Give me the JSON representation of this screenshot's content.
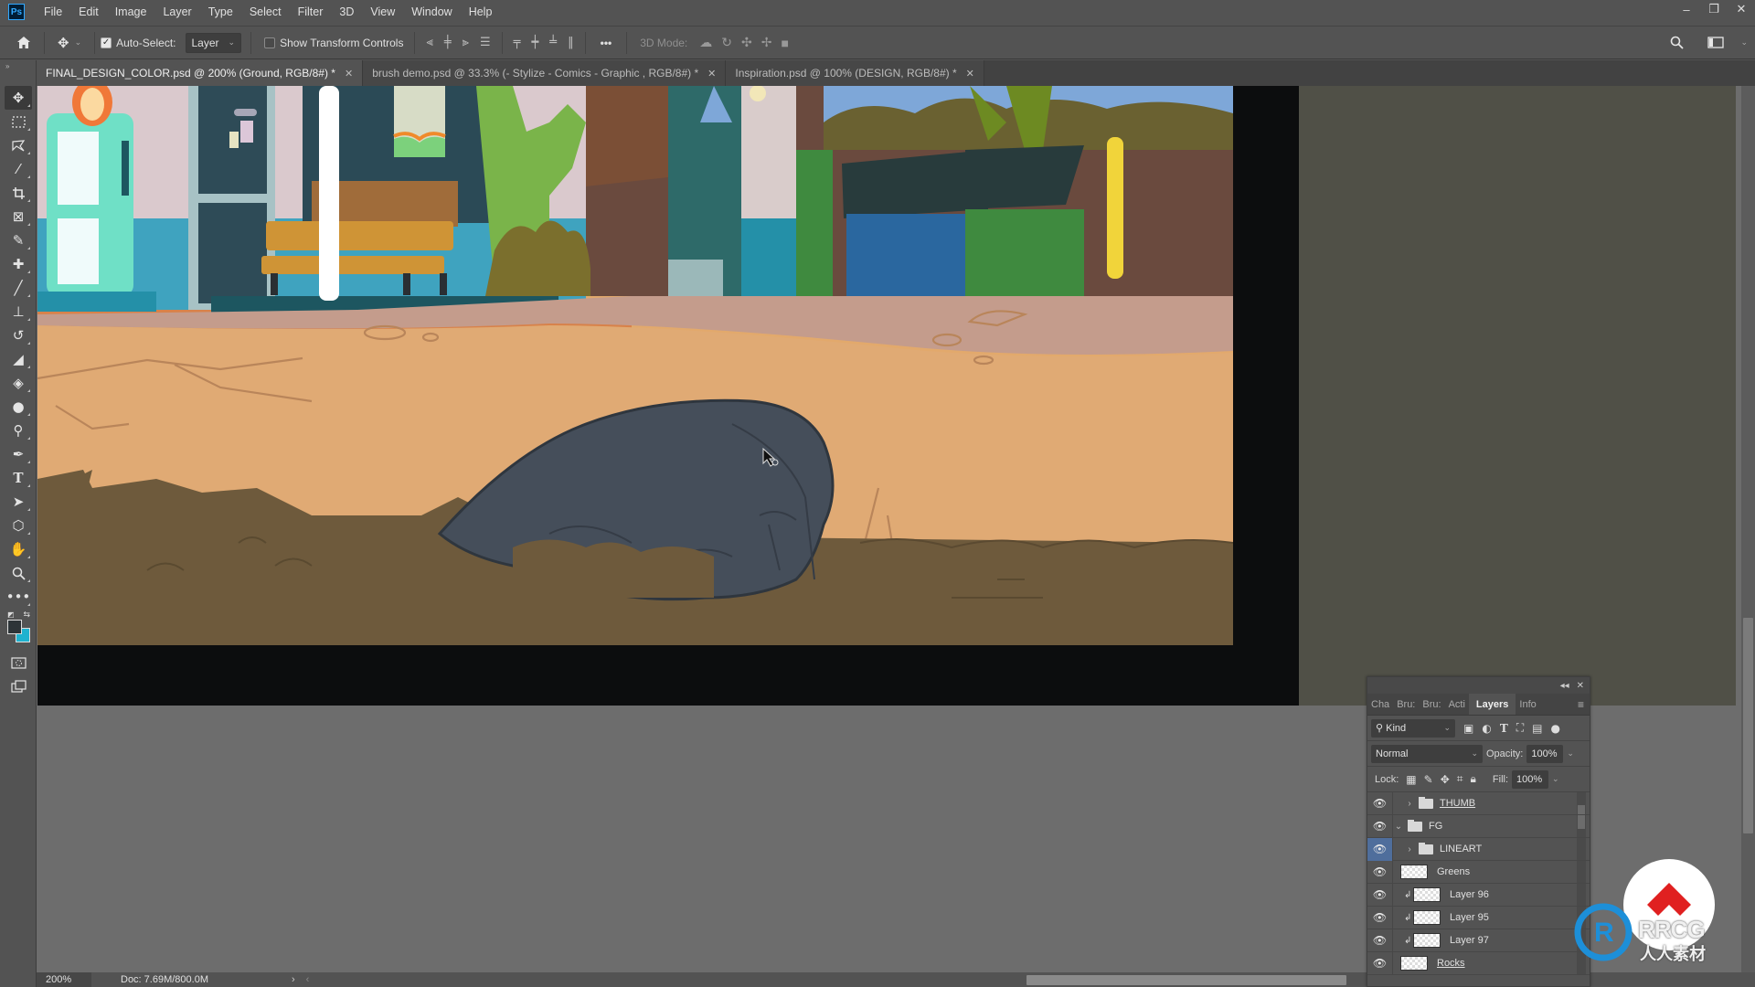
{
  "app": {
    "logo": "Ps",
    "name": "Adobe Photoshop"
  },
  "menu": [
    "File",
    "Edit",
    "Image",
    "Layer",
    "Type",
    "Select",
    "Filter",
    "3D",
    "View",
    "Window",
    "Help"
  ],
  "window_controls": {
    "minimize": "–",
    "restore": "❐",
    "close": "✕"
  },
  "options_bar": {
    "auto_select_label": "Auto-Select:",
    "auto_select_checked": true,
    "auto_select_target": "Layer",
    "show_transform_label": "Show Transform Controls",
    "show_transform_checked": false,
    "more_label": "•••",
    "mode_3d_label": "3D Mode:"
  },
  "tabs": [
    {
      "label": "FINAL_DESIGN_COLOR.psd @ 200% (Ground, RGB/8#) *",
      "active": true
    },
    {
      "label": "brush demo.psd @ 33.3% (- Stylize - Comics - Graphic  , RGB/8#) *",
      "active": false
    },
    {
      "label": "Inspiration.psd @ 100% (DESIGN, RGB/8#) *",
      "active": false
    }
  ],
  "tools": [
    "move",
    "rectangular-marquee",
    "lasso",
    "magic-wand",
    "crop",
    "frame",
    "eyedropper",
    "healing-brush",
    "brush",
    "clone-stamp",
    "history-brush",
    "eraser",
    "paint-bucket",
    "blur",
    "dodge",
    "pen",
    "type",
    "path-selection",
    "shape",
    "hand",
    "zoom",
    "edit-toolbar",
    "quick-mask",
    "screen-mode"
  ],
  "colors": {
    "foreground": "#2d3438",
    "background": "#1fb2cf",
    "selection_accent": "#4f6e9c"
  },
  "status": {
    "zoom": "200%",
    "doc": "Doc: 7.69M/800.0M",
    "arrow": "›",
    "back": "‹"
  },
  "layers_panel": {
    "tabs": [
      "Cha",
      "Bru:",
      "Bru:",
      "Acti",
      "Layers",
      "Info"
    ],
    "active_tab": "Layers",
    "filter_kind": "Kind",
    "blend_mode": "Normal",
    "opacity_label": "Opacity:",
    "opacity": "100%",
    "lock_label": "Lock:",
    "fill_label": "Fill:",
    "fill": "100%",
    "layers": [
      {
        "name": "THUMB",
        "type": "group",
        "expanded": false,
        "indent": 1,
        "visible": true,
        "underline": true
      },
      {
        "name": "FG",
        "type": "group",
        "expanded": true,
        "indent": 0,
        "visible": true
      },
      {
        "name": "LINEART",
        "type": "group",
        "expanded": false,
        "indent": 1,
        "visible": true,
        "selected_eye": true
      },
      {
        "name": "Greens",
        "type": "layer",
        "indent": 1,
        "visible": true
      },
      {
        "name": "Layer 96",
        "type": "layer",
        "clipped": true,
        "indent": 2,
        "visible": true
      },
      {
        "name": "Layer 95",
        "type": "layer",
        "clipped": true,
        "indent": 2,
        "visible": true
      },
      {
        "name": "Layer 97",
        "type": "layer",
        "clipped": true,
        "indent": 2,
        "visible": true
      },
      {
        "name": "Rocks",
        "type": "layer",
        "indent": 1,
        "visible": true,
        "underline": true
      }
    ]
  },
  "watermark": {
    "text": "RRCG",
    "subtext": "人人素材"
  }
}
